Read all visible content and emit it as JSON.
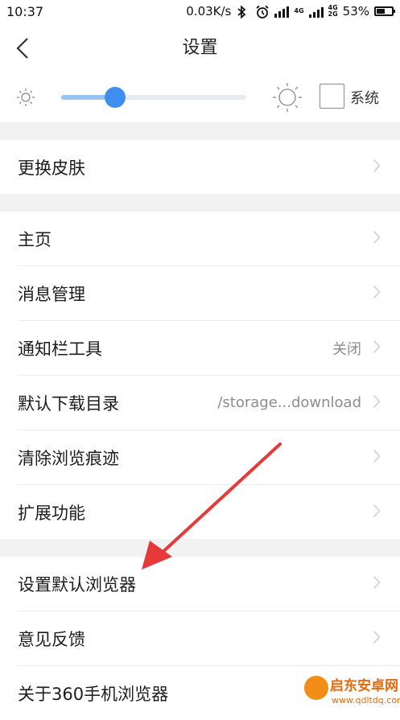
{
  "status_bar": {
    "time": "10:37",
    "speed": "0.03K/s",
    "net1": "4G",
    "net2": "4G",
    "net3": "2G",
    "battery": "53%",
    "battery_level": 0.53,
    "icons": [
      "bluetooth-icon",
      "alarm-icon",
      "signal-icon",
      "battery-icon"
    ]
  },
  "header": {
    "title": "设置",
    "back_icon": "chevron-left-icon"
  },
  "brightness": {
    "level": 0.29,
    "system_label": "系统",
    "system_checked": false,
    "accent": "#3d8ef0",
    "fill_color": "#99c3f2"
  },
  "sections": [
    {
      "items": [
        {
          "label": "更换皮肤",
          "value": ""
        }
      ]
    },
    {
      "items": [
        {
          "label": "主页",
          "value": ""
        },
        {
          "label": "消息管理",
          "value": ""
        },
        {
          "label": "通知栏工具",
          "value": "关闭"
        },
        {
          "label": "默认下载目录",
          "value": "/storage...download"
        },
        {
          "label": "清除浏览痕迹",
          "value": ""
        },
        {
          "label": "扩展功能",
          "value": ""
        }
      ]
    },
    {
      "items": [
        {
          "label": "设置默认浏览器",
          "value": ""
        },
        {
          "label": "意见反馈",
          "value": ""
        },
        {
          "label": "关于360手机浏览器",
          "value": ""
        }
      ]
    }
  ],
  "annotation": {
    "arrow_color": "#e8393a",
    "points_to": "设置默认浏览器"
  },
  "watermark": {
    "title": "启东安卓网",
    "subtitle": "www.qdltdq.com"
  }
}
